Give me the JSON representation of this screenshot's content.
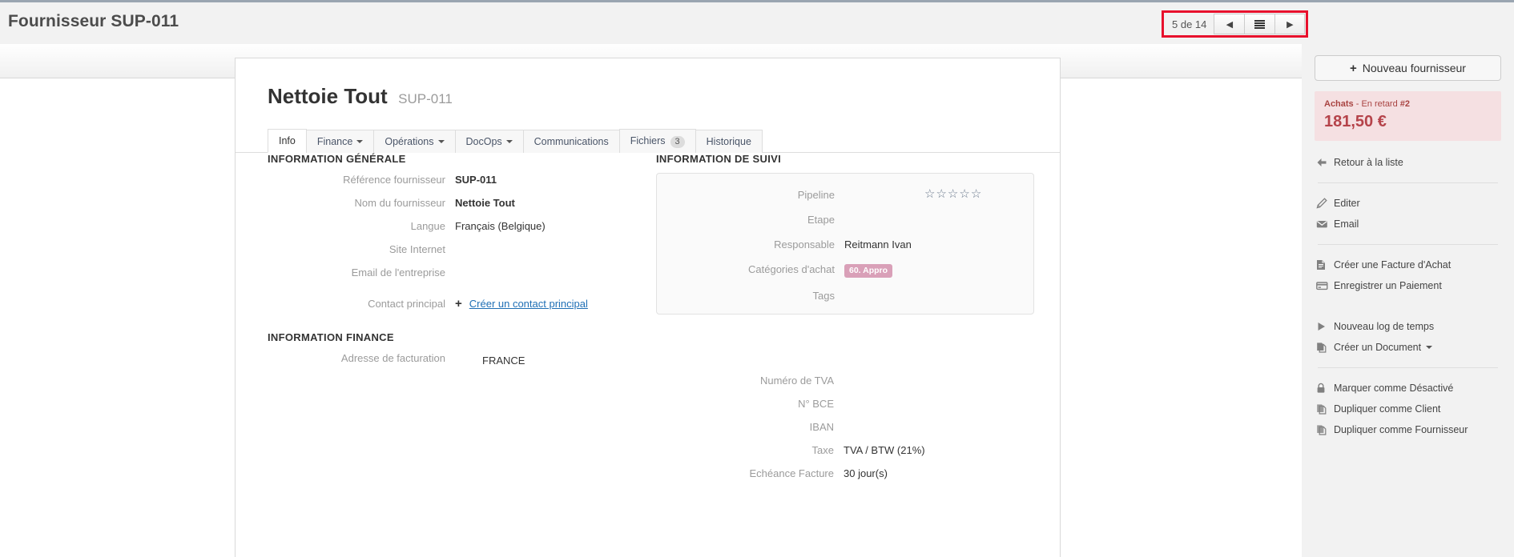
{
  "header": {
    "title": "Fournisseur SUP-011",
    "pager": {
      "count_label": "5 de 14",
      "prev_glyph": "◀",
      "next_glyph": "▶",
      "list_icon": "list-icon",
      "highlight_color": "#e8112d"
    }
  },
  "record": {
    "name": "Nettoie Tout",
    "reference": "SUP-011"
  },
  "tabs": [
    {
      "label": "Info",
      "active": true,
      "caret": false,
      "badge": null
    },
    {
      "label": "Finance",
      "active": false,
      "caret": true,
      "badge": null
    },
    {
      "label": "Opérations",
      "active": false,
      "caret": true,
      "badge": null
    },
    {
      "label": "DocOps",
      "active": false,
      "caret": true,
      "badge": null
    },
    {
      "label": "Communications",
      "active": false,
      "caret": false,
      "badge": null
    },
    {
      "label": "Fichiers",
      "active": false,
      "caret": false,
      "badge": "3"
    },
    {
      "label": "Historique",
      "active": false,
      "caret": false,
      "badge": null
    }
  ],
  "sections": {
    "general": {
      "title": "INFORMATION GÉNÉRALE",
      "fields": [
        {
          "label": "Référence fournisseur",
          "value": "SUP-011",
          "bold": true
        },
        {
          "label": "Nom du fournisseur",
          "value": "Nettoie Tout",
          "bold": true
        },
        {
          "label": "Langue",
          "value": "Français (Belgique)",
          "bold": false
        },
        {
          "label": "Site Internet",
          "value": "",
          "bold": false
        },
        {
          "label": "Email de l'entreprise",
          "value": "",
          "bold": false
        }
      ],
      "contact": {
        "label": "Contact principal",
        "plus": "+",
        "link": "Créer un contact principal",
        "link_color": "#1f6fb5"
      }
    },
    "suivi": {
      "title": "INFORMATION DE SUIVI",
      "fields": [
        {
          "label": "Pipeline",
          "value": ""
        },
        {
          "label": "Etape",
          "value": ""
        },
        {
          "label": "Responsable",
          "value": "Reitmann Ivan"
        },
        {
          "label": "Catégories d'achat",
          "value": ""
        },
        {
          "label": "Tags",
          "value": ""
        }
      ],
      "rating": {
        "stars_total": 5,
        "stars_filled": 0,
        "glyph": "☆"
      },
      "category_badge": {
        "label": "60. Appro",
        "color": "#d9a0b8"
      }
    },
    "finance": {
      "title": "INFORMATION FINANCE",
      "address_label": "Adresse de facturation",
      "address_lines": [
        "FRANCE"
      ],
      "fields": [
        {
          "label": "Numéro de TVA",
          "value": ""
        },
        {
          "label": "N° BCE",
          "value": ""
        },
        {
          "label": "IBAN",
          "value": ""
        },
        {
          "label": "Taxe",
          "value": "TVA / BTW (21%)"
        },
        {
          "label": "Echéance Facture",
          "value": "30 jour(s)"
        }
      ]
    }
  },
  "sidebar": {
    "new_button": {
      "label": "Nouveau fournisseur",
      "plus": "+"
    },
    "alert": {
      "prefix": "Achats",
      "separator": " - ",
      "status": "En retard",
      "count": "#2",
      "amount": "181,50 €",
      "bg_color": "#f5e0e2",
      "text_color": "#a94442"
    },
    "groups": [
      {
        "items": [
          {
            "label": "Retour à la liste",
            "icon": "arrow-left-icon",
            "caret": false
          }
        ]
      },
      {
        "items": [
          {
            "label": "Editer",
            "icon": "pencil-icon",
            "caret": false
          },
          {
            "label": "Email",
            "icon": "envelope-icon",
            "caret": false
          }
        ]
      },
      {
        "items": [
          {
            "label": "Créer une Facture d'Achat",
            "icon": "document-icon",
            "caret": false
          },
          {
            "label": "Enregistrer un Paiement",
            "icon": "credit-card-icon",
            "caret": false
          }
        ]
      },
      {
        "items": [
          {
            "label": "Nouveau log de temps",
            "icon": "play-icon",
            "caret": false
          },
          {
            "label": "Créer un Document",
            "icon": "copy-document-icon",
            "caret": true
          }
        ]
      },
      {
        "items": [
          {
            "label": "Marquer comme Désactivé",
            "icon": "lock-icon",
            "caret": false
          },
          {
            "label": "Dupliquer comme Client",
            "icon": "copy-icon",
            "caret": false
          },
          {
            "label": "Dupliquer comme Fournisseur",
            "icon": "copy-icon",
            "caret": false
          }
        ]
      }
    ]
  }
}
